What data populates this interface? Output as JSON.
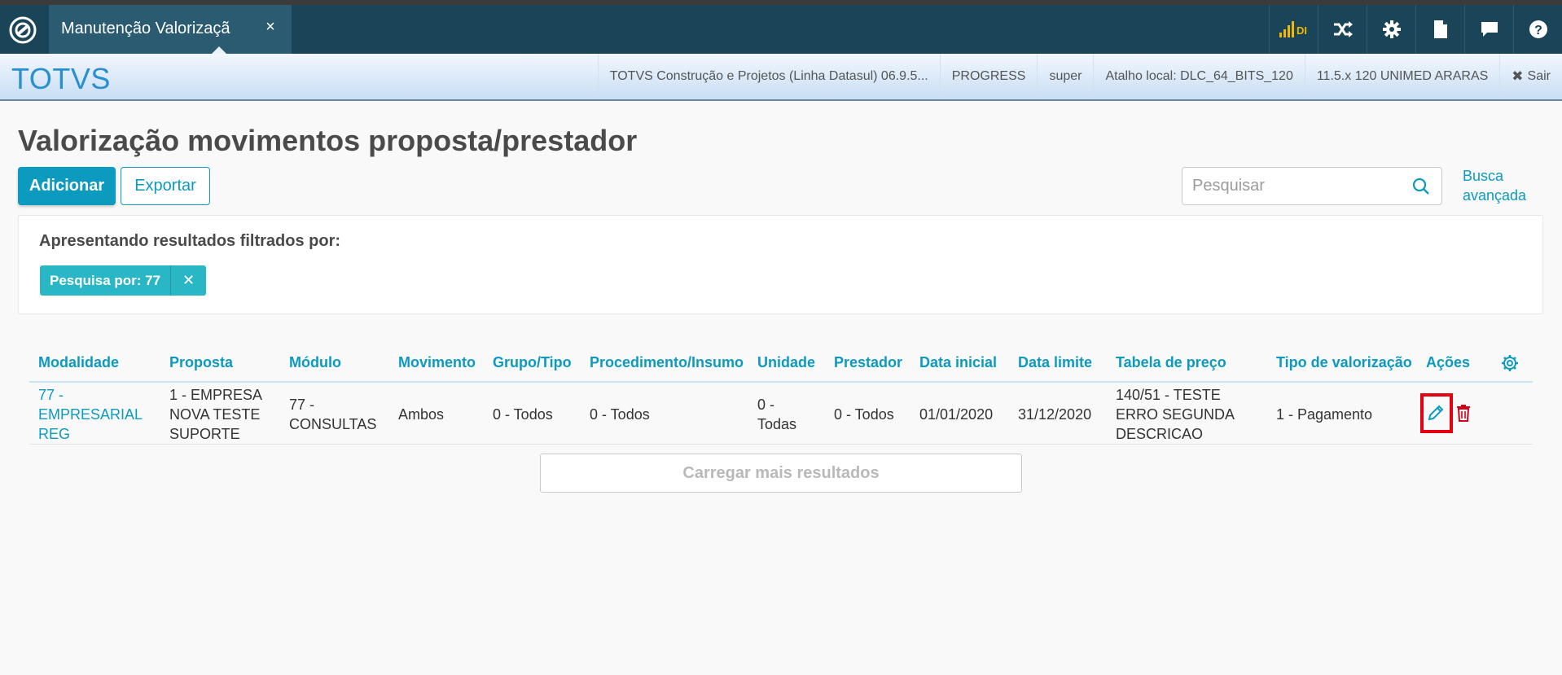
{
  "app": {
    "tab_title": "Manutenção Valorizaçã",
    "tab_close": "×",
    "top_icons": [
      "signal-icon",
      "shuffle-icon",
      "gear-icon",
      "document-icon",
      "chat-icon",
      "help-icon"
    ],
    "signal_label": "DI"
  },
  "brandbar": {
    "brand": "TOTVS",
    "items": [
      "TOTVS Construção e Projetos (Linha Datasul) 06.9.5...",
      "PROGRESS",
      "super",
      "Atalho local: DLC_64_BITS_120",
      "11.5.x 120 UNIMED ARARAS"
    ],
    "exit_icon": "✖",
    "exit_label": "Sair"
  },
  "page": {
    "title": "Valorização movimentos proposta/prestador",
    "add_label": "Adicionar",
    "export_label": "Exportar",
    "search_placeholder": "Pesquisar",
    "advanced_search_line1": "Busca",
    "advanced_search_line2": "avançada"
  },
  "filter": {
    "label": "Apresentando resultados filtrados por:",
    "chip_label": "Pesquisa por: 77",
    "chip_close": "✕"
  },
  "table": {
    "columns": [
      "Modalidade",
      "Proposta",
      "Módulo",
      "Movimento",
      "Grupo/Tipo",
      "Procedimento/Insumo",
      "Unidade",
      "Prestador",
      "Data inicial",
      "Data limite",
      "Tabela de preço",
      "Tipo de valorização",
      "Ações"
    ],
    "rows": [
      {
        "modalidade": "77 - EMPRESARIAL REG",
        "proposta": "1 - EMPRESA NOVA TESTE SUPORTE",
        "modulo": "77 - CONSULTAS",
        "movimento": "Ambos",
        "grupo_tipo": "0 - Todos",
        "procedimento": "0 - Todos",
        "unidade": "0 - Todas",
        "prestador": "0 - Todos",
        "data_inicial": "01/01/2020",
        "data_limite": "31/12/2020",
        "tabela_preco": "140/51 - TESTE ERRO SEGUNDA DESCRICAO",
        "tipo_valorizacao": "1 - Pagamento"
      }
    ],
    "load_more": "Carregar mais resultados"
  },
  "colors": {
    "topbar": "#1a4457",
    "accent": "#0c9abe",
    "chip": "#29b6c5",
    "delete": "#d0021b",
    "highlight": "#e3000f"
  }
}
